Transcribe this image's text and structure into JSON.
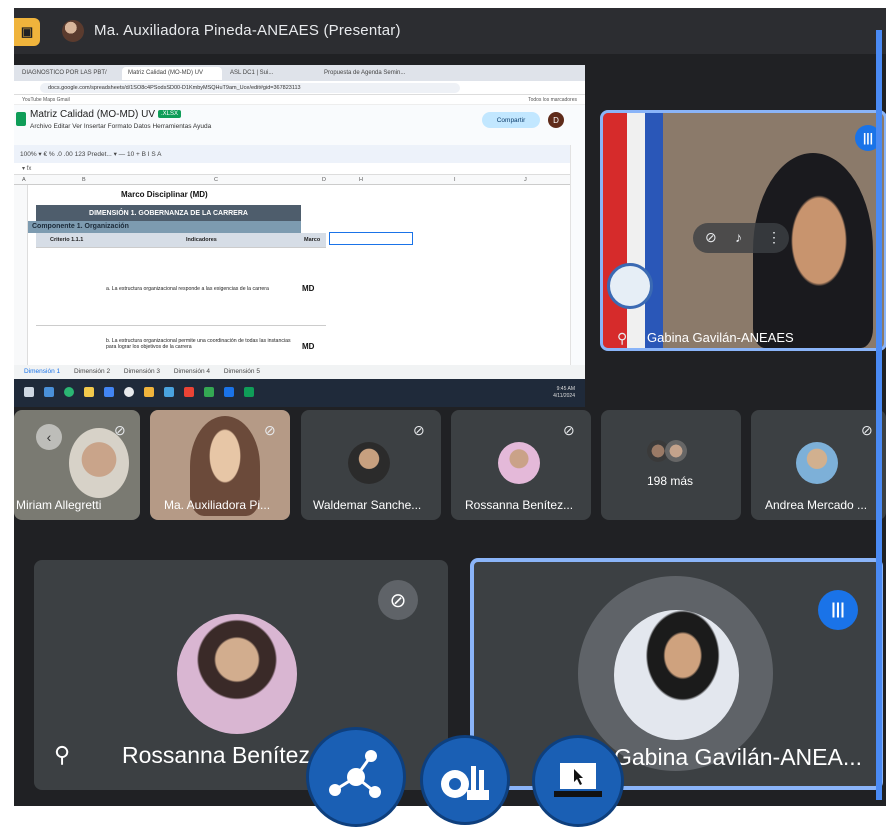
{
  "header": {
    "presenter_label": "Ma. Auxiliadora Pineda-ANEAES (Presentar)",
    "present_icon": "presentation-icon"
  },
  "shared_screen": {
    "browser_tabs": [
      "DIAGNOSTICO POR LAS PBT/",
      "Matriz Calidad (MO-MD) UV",
      "ASL DC1 | Sui...",
      "Propuesta de Agenda Semin..."
    ],
    "url": "docs.google.com/spreadsheets/d/1SO8c4PSodsSD00-D1KmbyMSQHuT9am_Uce/edit#gid=367823113",
    "bookmarks": "YouTube   Maps   Gmail",
    "bookmarks_right": "Todos los marcadores",
    "doc_title": "Matriz Calidad (MO-MD) UV",
    "doc_badge": ".XLSX",
    "menu": "Archivo  Editar  Ver  Insertar  Formato  Datos  Herramientas  Ayuda",
    "share_label": "Compartir",
    "profile_initial": "D",
    "toolbar_text": "100%   ▾   €   %   .0   .00   123   Predet...   ▾   —   10   +   B   I   S   A",
    "formula_cell": "▾   fx",
    "columns": [
      "A",
      "B",
      "C",
      "D",
      "H",
      "I",
      "J"
    ],
    "table_title": "Marco Disciplinar (MD)",
    "dimension": "DIMENSIÓN 1. GOBERNANZA DE LA CARRERA",
    "component": "Componente 1. Organización",
    "col_criterio": "Criterio 1.1.1",
    "col_indicadores": "Indicadores",
    "col_marco": "Marco",
    "indicator_a": "a. La estructura organizacional responde a las exigencias de la carrera",
    "indicator_b": "b. La estructura organizacional permite una coordinación de todas las instancias para lograr los objetivos de la carrera",
    "md_a": "MD",
    "md_b": "MD",
    "sheet_tabs": [
      "Dimensión 1",
      "Dimensión 2",
      "Dimensión 3",
      "Dimensión 4",
      "Dimensión 5"
    ],
    "clock_time": "9:45 AM",
    "clock_date": "4/11/2024"
  },
  "pinned_tile": {
    "name": "Gabina Gavilán-ANEAES",
    "pin_icon": "pin-icon"
  },
  "filmstrip": [
    {
      "name": "Miriam Allegretti"
    },
    {
      "name": "Ma. Auxiliadora Pi..."
    },
    {
      "name": "Waldemar Sanche..."
    },
    {
      "name": "Rossanna Benítez..."
    },
    {
      "name": "198 más"
    },
    {
      "name": "Andrea Mercado ..."
    }
  ],
  "large_tiles": {
    "left_name": "Rossanna Benítez",
    "right_name": "Gabina Gavilán-ANEA..."
  },
  "colors": {
    "meet_bg": "#202124",
    "tile_bg": "#3c4043",
    "accent_blue": "#1a73e8",
    "active_border": "#8ab4f8"
  },
  "overlay_icons": [
    "network-icon",
    "factory-gear-icon",
    "laptop-cursor-icon"
  ]
}
